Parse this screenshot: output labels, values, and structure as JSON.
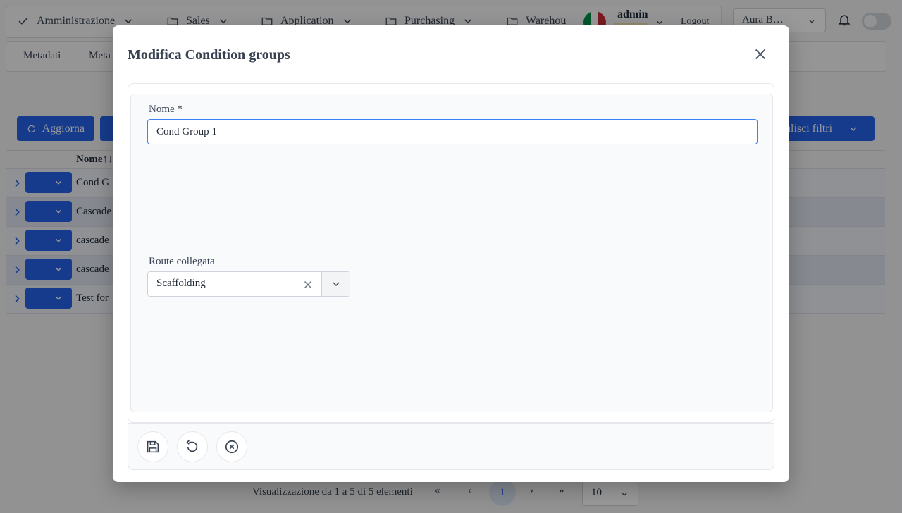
{
  "nav": {
    "items": [
      "Amministrazione",
      "Sales",
      "Application",
      "Purchasing",
      "Warehou"
    ],
    "user": "admin",
    "logout": "Logout",
    "tenant": "Aura B…"
  },
  "subnav": {
    "tabs": [
      "Metadati",
      "Meta"
    ]
  },
  "toolbar": {
    "refresh": "Aggiorna",
    "clear_filters": "ulisci filtri"
  },
  "table": {
    "header_name": "Nome",
    "rows": [
      "Cond G",
      "Cascade",
      "cascade",
      "cascade",
      "Test for"
    ]
  },
  "pager": {
    "summary": "Visualizzazione da 1 a 5 di 5 elementi",
    "current_page": "1",
    "page_size": "10"
  },
  "modal": {
    "title": "Modifica Condition groups",
    "name_label": "Nome *",
    "name_value": "Cond Group 1",
    "route_label": "Route collegata",
    "route_value": "Scaffolding"
  },
  "colors": {
    "primary": "#2563eb",
    "flag_green": "#009246",
    "flag_white": "#ffffff",
    "flag_red": "#ce2b37"
  }
}
